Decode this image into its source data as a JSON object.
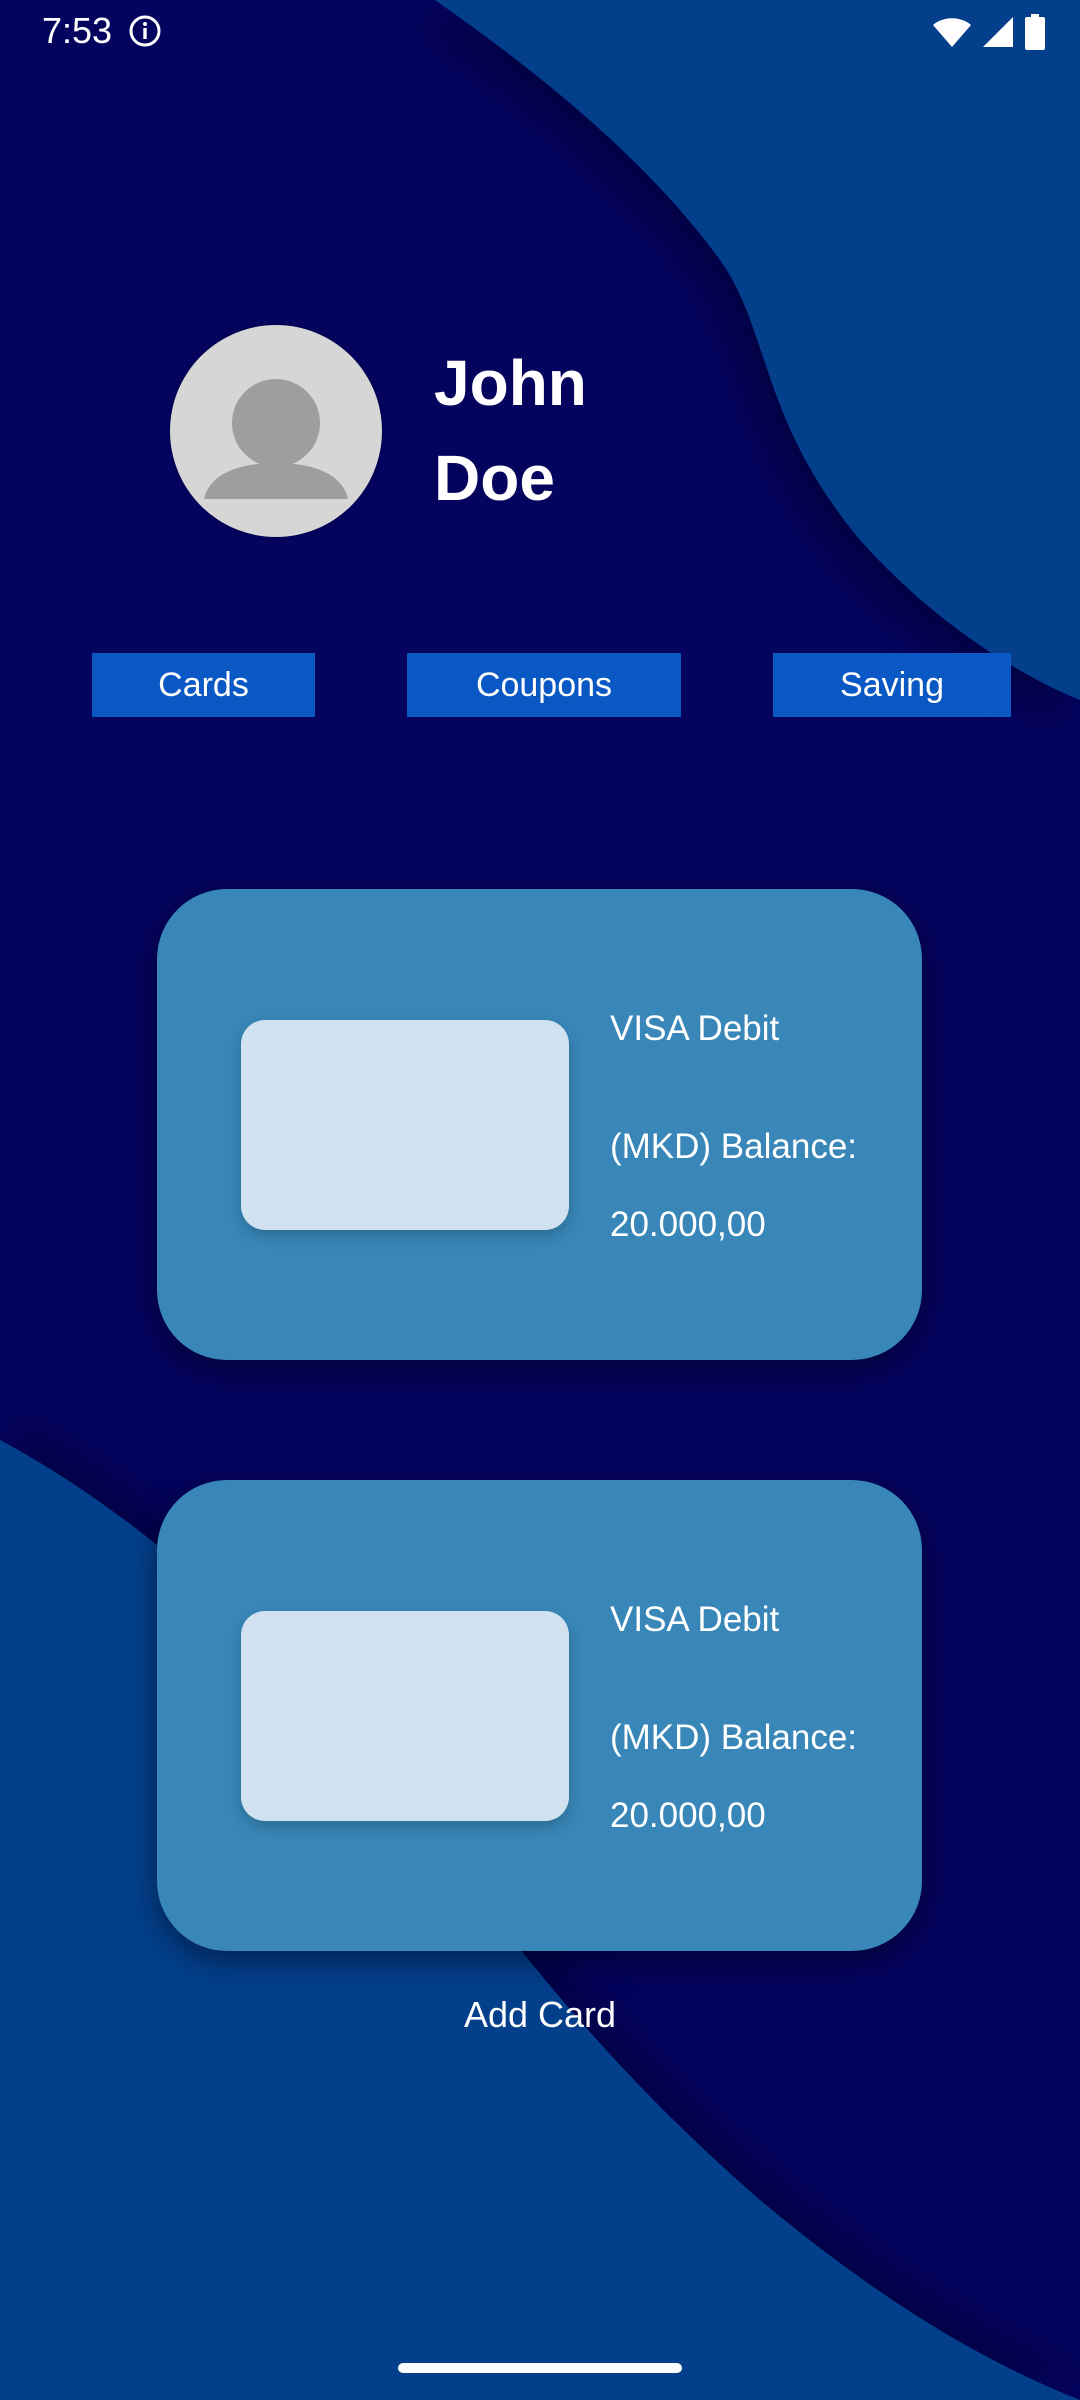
{
  "status_bar": {
    "time": "7:53",
    "icons": [
      "info-icon",
      "wifi-icon",
      "signal-icon",
      "battery-icon"
    ]
  },
  "profile": {
    "first_name": "John",
    "last_name": "Doe",
    "avatar_icon": "person-icon"
  },
  "tabs": [
    {
      "label": "Cards"
    },
    {
      "label": "Coupons"
    },
    {
      "label": "Saving"
    }
  ],
  "cards": [
    {
      "title": "VISA Debit",
      "balance_label": "(MKD) Balance:",
      "balance_value": "20.000,00"
    },
    {
      "title": "VISA Debit",
      "balance_label": "(MKD) Balance:",
      "balance_value": "20.000,00"
    }
  ],
  "add_card_label": "Add Card",
  "colors": {
    "background_dark": "#04035d",
    "wave_blue": "#033f8b",
    "tab_blue": "#0a58c4",
    "card_blue": "#3887b8",
    "card_image": "#d0e2f0"
  }
}
